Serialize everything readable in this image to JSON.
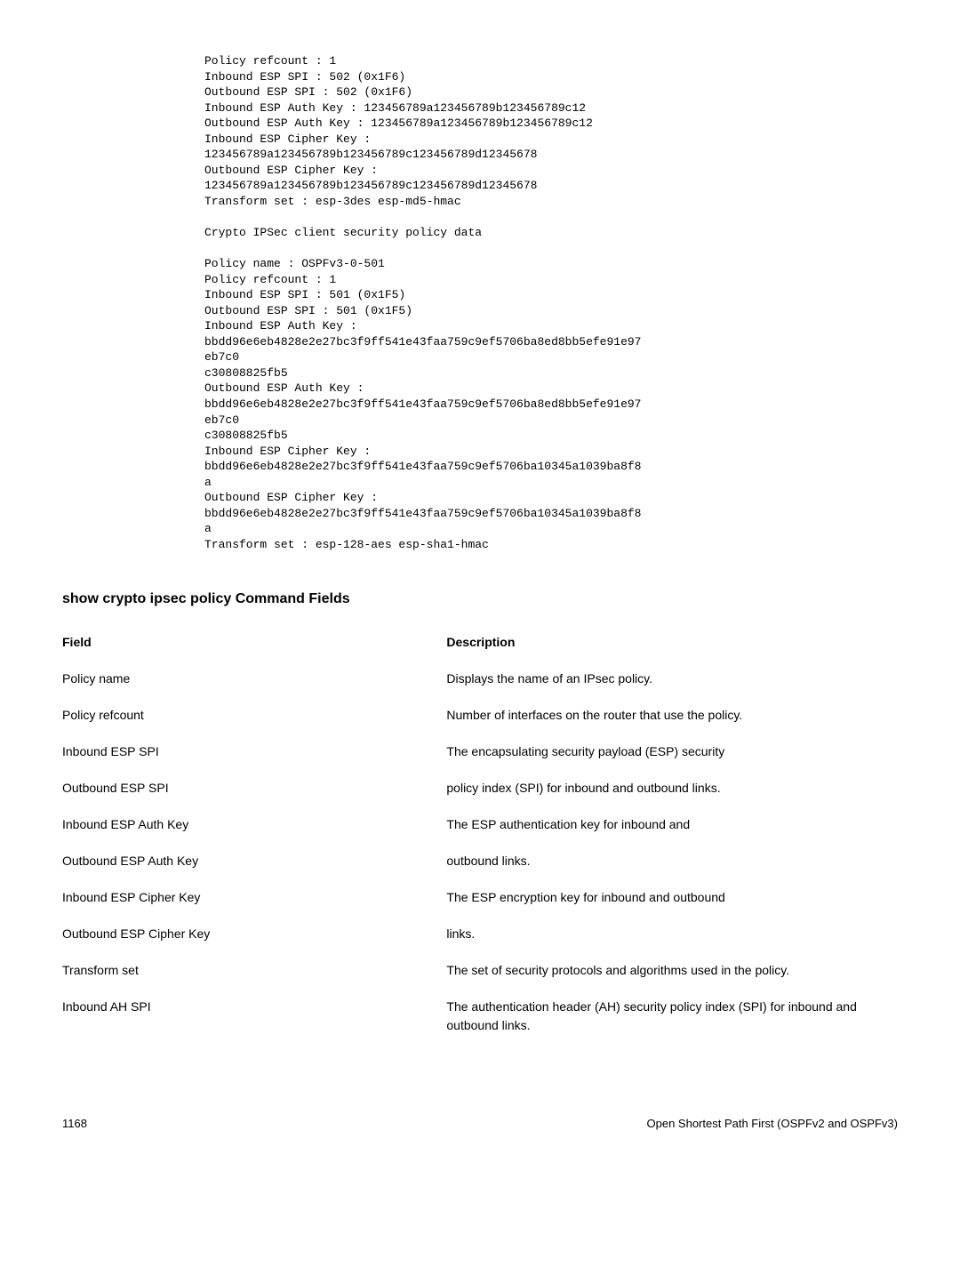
{
  "code": "Policy refcount : 1\nInbound ESP SPI : 502 (0x1F6)\nOutbound ESP SPI : 502 (0x1F6)\nInbound ESP Auth Key : 123456789a123456789b123456789c12\nOutbound ESP Auth Key : 123456789a123456789b123456789c12\nInbound ESP Cipher Key :\n123456789a123456789b123456789c123456789d12345678\nOutbound ESP Cipher Key :\n123456789a123456789b123456789c123456789d12345678\nTransform set : esp-3des esp-md5-hmac\n\nCrypto IPSec client security policy data\n\nPolicy name : OSPFv3-0-501\nPolicy refcount : 1\nInbound ESP SPI : 501 (0x1F5)\nOutbound ESP SPI : 501 (0x1F5)\nInbound ESP Auth Key :\nbbdd96e6eb4828e2e27bc3f9ff541e43faa759c9ef5706ba8ed8bb5efe91e97\neb7c0\nc30808825fb5\nOutbound ESP Auth Key :\nbbdd96e6eb4828e2e27bc3f9ff541e43faa759c9ef5706ba8ed8bb5efe91e97\neb7c0\nc30808825fb5\nInbound ESP Cipher Key :\nbbdd96e6eb4828e2e27bc3f9ff541e43faa759c9ef5706ba10345a1039ba8f8\na\nOutbound ESP Cipher Key :\nbbdd96e6eb4828e2e27bc3f9ff541e43faa759c9ef5706ba10345a1039ba8f8\na\nTransform set : esp-128-aes esp-sha1-hmac",
  "section_title": "show crypto ipsec policy Command Fields",
  "table": {
    "header_field": "Field",
    "header_desc": "Description",
    "rows": [
      {
        "field": "Policy name",
        "desc": "Displays the name of an IPsec policy."
      },
      {
        "field": "Policy refcount",
        "desc": "Number of interfaces on the router that use the policy."
      },
      {
        "field": "Inbound ESP SPI",
        "desc": "The encapsulating security payload (ESP) security"
      },
      {
        "field": "Outbound ESP SPI",
        "desc": "policy index (SPI) for inbound and outbound links."
      },
      {
        "field": "Inbound ESP Auth Key",
        "desc": "The ESP authentication key for inbound and"
      },
      {
        "field": "Outbound ESP Auth Key",
        "desc": "outbound links."
      },
      {
        "field": "Inbound ESP Cipher Key",
        "desc": "The ESP encryption key for inbound and outbound"
      },
      {
        "field": "Outbound ESP Cipher Key",
        "desc": "links."
      },
      {
        "field": "Transform set",
        "desc": "The set of security protocols and algorithms used in the policy."
      },
      {
        "field": "Inbound AH SPI",
        "desc": "The authentication header (AH) security policy index (SPI) for inbound and outbound links."
      }
    ]
  },
  "footer": {
    "page": "1168",
    "title": "Open Shortest Path First (OSPFv2 and OSPFv3)"
  }
}
